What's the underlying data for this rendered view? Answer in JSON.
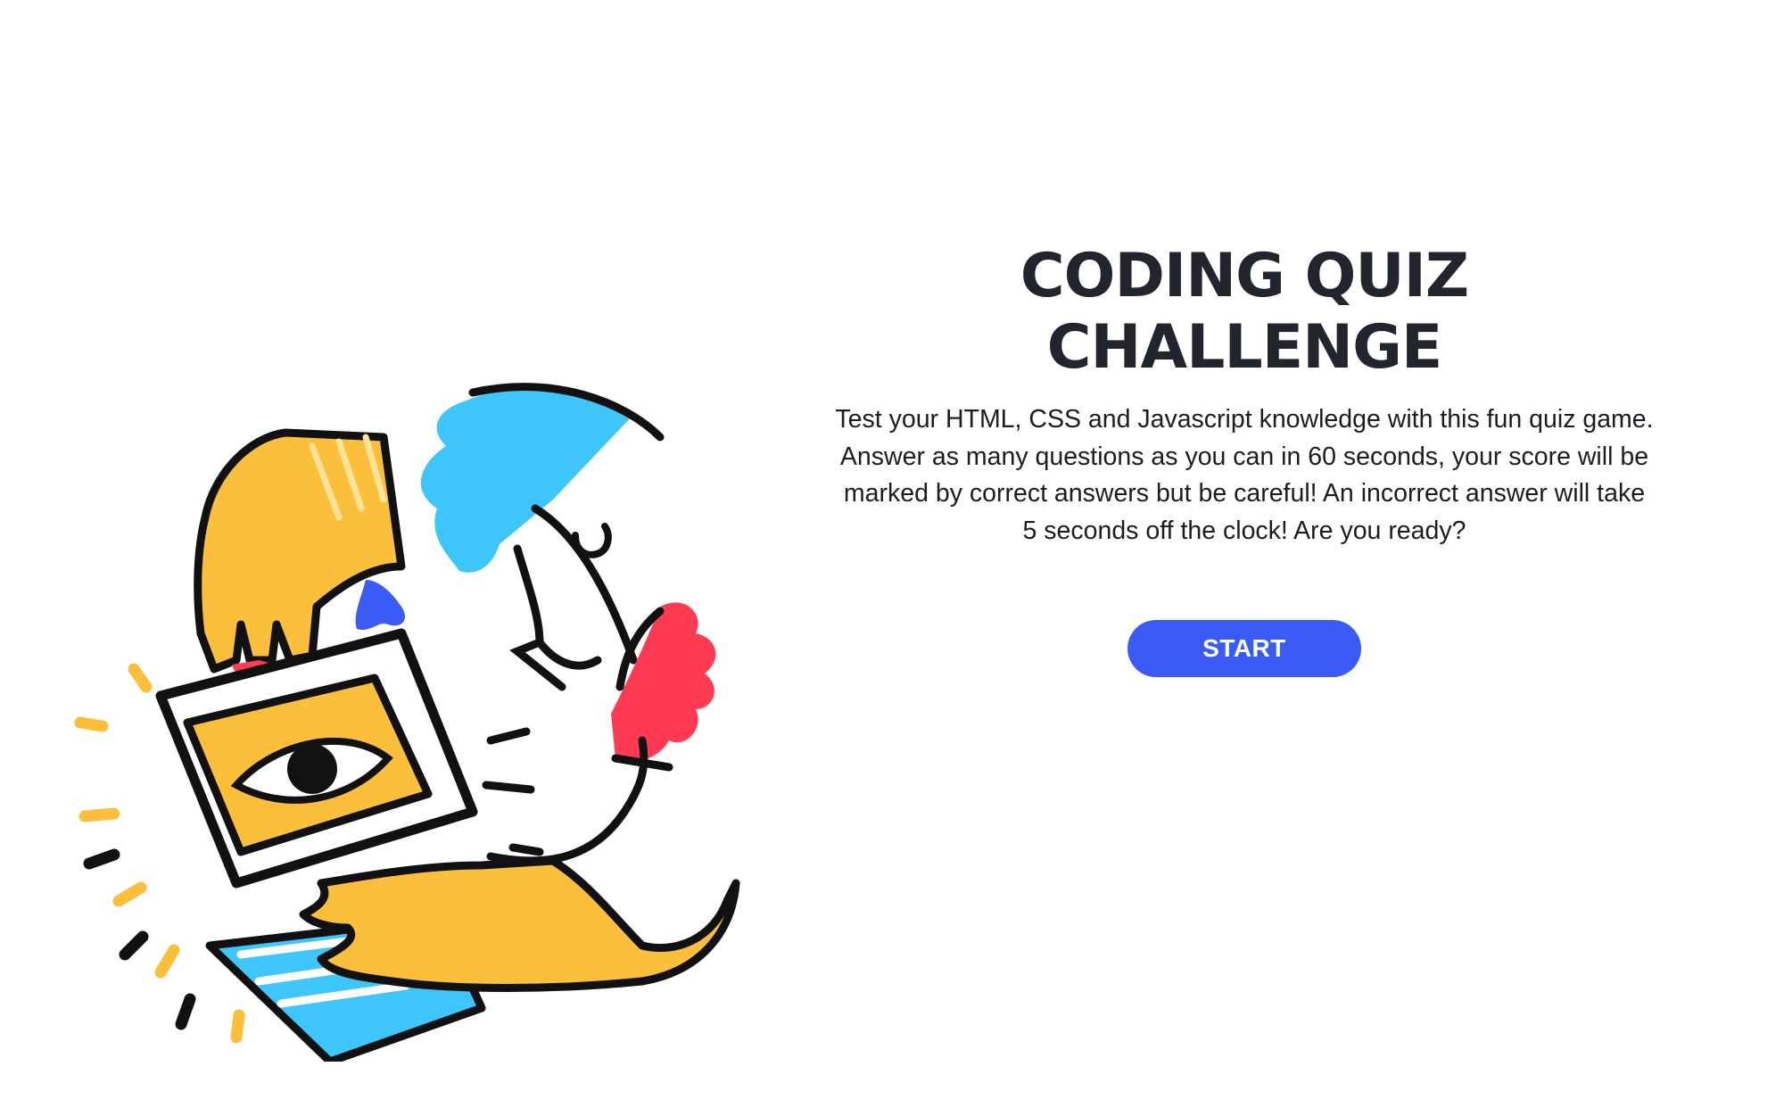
{
  "main": {
    "title": "CODING QUIZ CHALLENGE",
    "description": "Test your HTML, CSS and Javascript knowledge with this fun quiz game. Answer as many questions as you can in 60 seconds, your score will be marked by correct answers but be careful! An incorrect answer will take 5 seconds off the clock! Are you ready?",
    "start_label": "START"
  },
  "illustration": {
    "name": "person-with-laptop-illustration",
    "colors": {
      "yellow": "#fbbf3c",
      "blue": "#3ec6fb",
      "red": "#ff3b54",
      "indigo": "#3b5bf6",
      "ink": "#111111"
    }
  },
  "colors": {
    "accent": "#3b5bf6",
    "title": "#22252e",
    "text": "#1c1c22"
  }
}
